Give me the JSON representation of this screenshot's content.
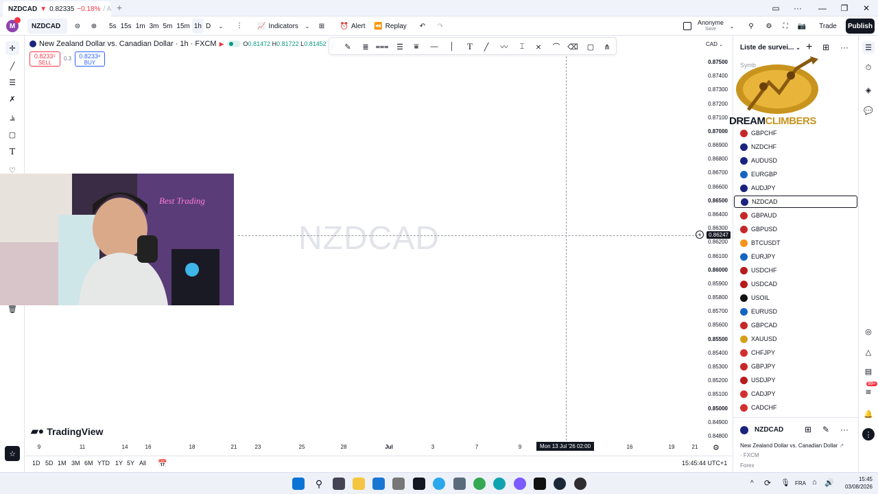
{
  "browser": {
    "tab_symbol": "NZDCAD",
    "tab_price": "0.82335",
    "tab_change": "−0.18%",
    "tab_suffix": "/ An"
  },
  "toolbar": {
    "symbol": "NZDCAD",
    "intervals": [
      "5s",
      "15s",
      "1m",
      "3m",
      "5m",
      "15m",
      "1h",
      "D"
    ],
    "active_interval": "1h",
    "indicators_label": "Indicators",
    "alert_label": "Alert",
    "replay_label": "Replay",
    "account_name": "Anonyme",
    "account_status": "Save",
    "trade_label": "Trade",
    "publish_label": "Publish"
  },
  "legend": {
    "title": "New Zealand Dollar vs. Canadian Dollar · 1h · FXCM",
    "o_label": "O",
    "o_value": "0.81472",
    "h_label": "H",
    "h_value": "0.81722",
    "l_label": "L",
    "l_value": "0.81452",
    "sell_price": "0.8233⁵",
    "sell_label": "SELL",
    "spread": "0.3",
    "buy_price": "0.8233⁸",
    "buy_label": "BUY"
  },
  "chart": {
    "watermark": "NZDCAD",
    "currency": "CAD",
    "current_price": "0.86247",
    "crosshair_time": "Mon 13 Jul '26   02:00",
    "price_labels": [
      {
        "text": "0.87500",
        "bold": true
      },
      {
        "text": "0.87400",
        "bold": false
      },
      {
        "text": "0.87300",
        "bold": false
      },
      {
        "text": "0.87200",
        "bold": false
      },
      {
        "text": "0.87100",
        "bold": false
      },
      {
        "text": "0.87000",
        "bold": true
      },
      {
        "text": "0.86900",
        "bold": false
      },
      {
        "text": "0.86800",
        "bold": false
      },
      {
        "text": "0.86700",
        "bold": false
      },
      {
        "text": "0.86600",
        "bold": false
      },
      {
        "text": "0.86500",
        "bold": true
      },
      {
        "text": "0.86400",
        "bold": false
      },
      {
        "text": "0.86300",
        "bold": false
      },
      {
        "text": "0.86200",
        "bold": false
      },
      {
        "text": "0.86100",
        "bold": false
      },
      {
        "text": "0.86000",
        "bold": true
      },
      {
        "text": "0.85900",
        "bold": false
      },
      {
        "text": "0.85800",
        "bold": false
      },
      {
        "text": "0.85700",
        "bold": false
      },
      {
        "text": "0.85600",
        "bold": false
      },
      {
        "text": "0.85500",
        "bold": true
      },
      {
        "text": "0.85400",
        "bold": false
      },
      {
        "text": "0.85300",
        "bold": false
      },
      {
        "text": "0.85200",
        "bold": false
      },
      {
        "text": "0.85100",
        "bold": false
      },
      {
        "text": "0.85000",
        "bold": true
      },
      {
        "text": "0.84900",
        "bold": false
      },
      {
        "text": "0.84800",
        "bold": false
      }
    ],
    "time_labels": [
      "9",
      "11",
      "14",
      "16",
      "18",
      "21",
      "23",
      "25",
      "28",
      "Jul",
      "3",
      "7",
      "9",
      "16",
      "19",
      "21"
    ],
    "logo_text": "TradingView"
  },
  "bottombar": {
    "ranges": [
      "1D",
      "5D",
      "1M",
      "3M",
      "6M",
      "YTD",
      "1Y",
      "5Y",
      "All"
    ],
    "clock": "15:45:44 UTC+1"
  },
  "watchlist": {
    "title": "Liste de survei...",
    "column_symbol": "Symb",
    "overlay_logo": "DREAMCLIMBERS",
    "items": [
      {
        "sym": "GBPCHF",
        "color": "#c62828"
      },
      {
        "sym": "NZDCHF",
        "color": "#1a237e"
      },
      {
        "sym": "AUDUSD",
        "color": "#1a237e"
      },
      {
        "sym": "EURGBP",
        "color": "#1565c0"
      },
      {
        "sym": "AUDJPY",
        "color": "#1a237e"
      },
      {
        "sym": "NZDCAD",
        "color": "#1a237e"
      },
      {
        "sym": "GBPAUD",
        "color": "#c62828"
      },
      {
        "sym": "GBPUSD",
        "color": "#c62828"
      },
      {
        "sym": "BTCUSDT",
        "color": "#f7931a"
      },
      {
        "sym": "EURJPY",
        "color": "#1565c0"
      },
      {
        "sym": "USDCHF",
        "color": "#b71c1c"
      },
      {
        "sym": "USDCAD",
        "color": "#b71c1c"
      },
      {
        "sym": "USOIL",
        "color": "#111111"
      },
      {
        "sym": "EURUSD",
        "color": "#1565c0"
      },
      {
        "sym": "GBPCAD",
        "color": "#c62828"
      },
      {
        "sym": "XAUUSD",
        "color": "#d4a017"
      },
      {
        "sym": "CHFJPY",
        "color": "#d32f2f"
      },
      {
        "sym": "GBPJPY",
        "color": "#c62828"
      },
      {
        "sym": "USDJPY",
        "color": "#b71c1c"
      },
      {
        "sym": "CADJPY",
        "color": "#d32f2f"
      },
      {
        "sym": "CADCHF",
        "color": "#d32f2f"
      }
    ],
    "selected": "NZDCAD",
    "details": {
      "symbol": "NZDCAD",
      "name": "New Zealand Dollar vs. Canadian Dollar",
      "exchange": "· FXCM",
      "type": "Forex"
    }
  },
  "rightbar": {
    "badge": "99+"
  },
  "taskbar": {
    "lang": "FRA",
    "time": "15:45",
    "date": "03/08/2026"
  },
  "colors": {
    "down": "#f23645",
    "up": "#089981",
    "accent": "#2962ff",
    "dark": "#131722"
  }
}
